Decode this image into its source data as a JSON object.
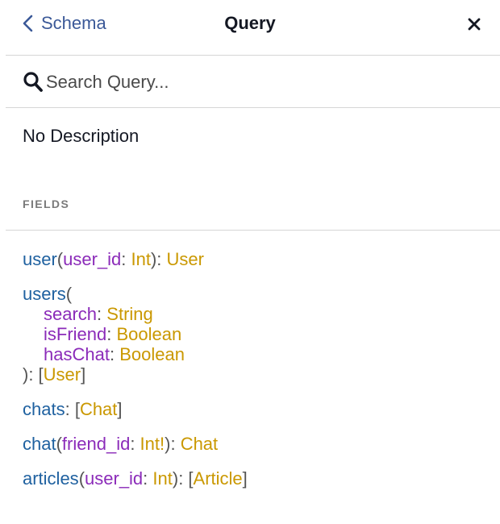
{
  "header": {
    "back_label": "Schema",
    "title": "Query",
    "close_glyph": "✕"
  },
  "search": {
    "placeholder": "Search Query...",
    "value": ""
  },
  "description": "No Description",
  "fields_section": {
    "title": "FIELDS",
    "fields": [
      {
        "name": "user",
        "args": [
          {
            "name": "user_id",
            "type": "Int"
          }
        ],
        "return_type": "User"
      },
      {
        "name": "users",
        "args": [
          {
            "name": "search",
            "type": "String"
          },
          {
            "name": "isFriend",
            "type": "Boolean"
          },
          {
            "name": "hasChat",
            "type": "Boolean"
          }
        ],
        "return_type": "User"
      },
      {
        "name": "chats",
        "args": [],
        "return_type": "Chat"
      },
      {
        "name": "chat",
        "args": [
          {
            "name": "friend_id",
            "type": "Int!"
          }
        ],
        "return_type": "Chat"
      },
      {
        "name": "articles",
        "args": [
          {
            "name": "user_id",
            "type": "Int"
          }
        ],
        "return_type": "Article"
      }
    ]
  },
  "colors": {
    "link": "#3b5998",
    "field_name": "#1f61a0",
    "arg_name": "#8b2bb9",
    "type_name": "#ca9800",
    "section_title": "#7a7a7a",
    "divider": "#d6d6d6"
  },
  "icons": {
    "back": "chevron-left-icon",
    "close": "close-icon",
    "search": "search-icon"
  }
}
